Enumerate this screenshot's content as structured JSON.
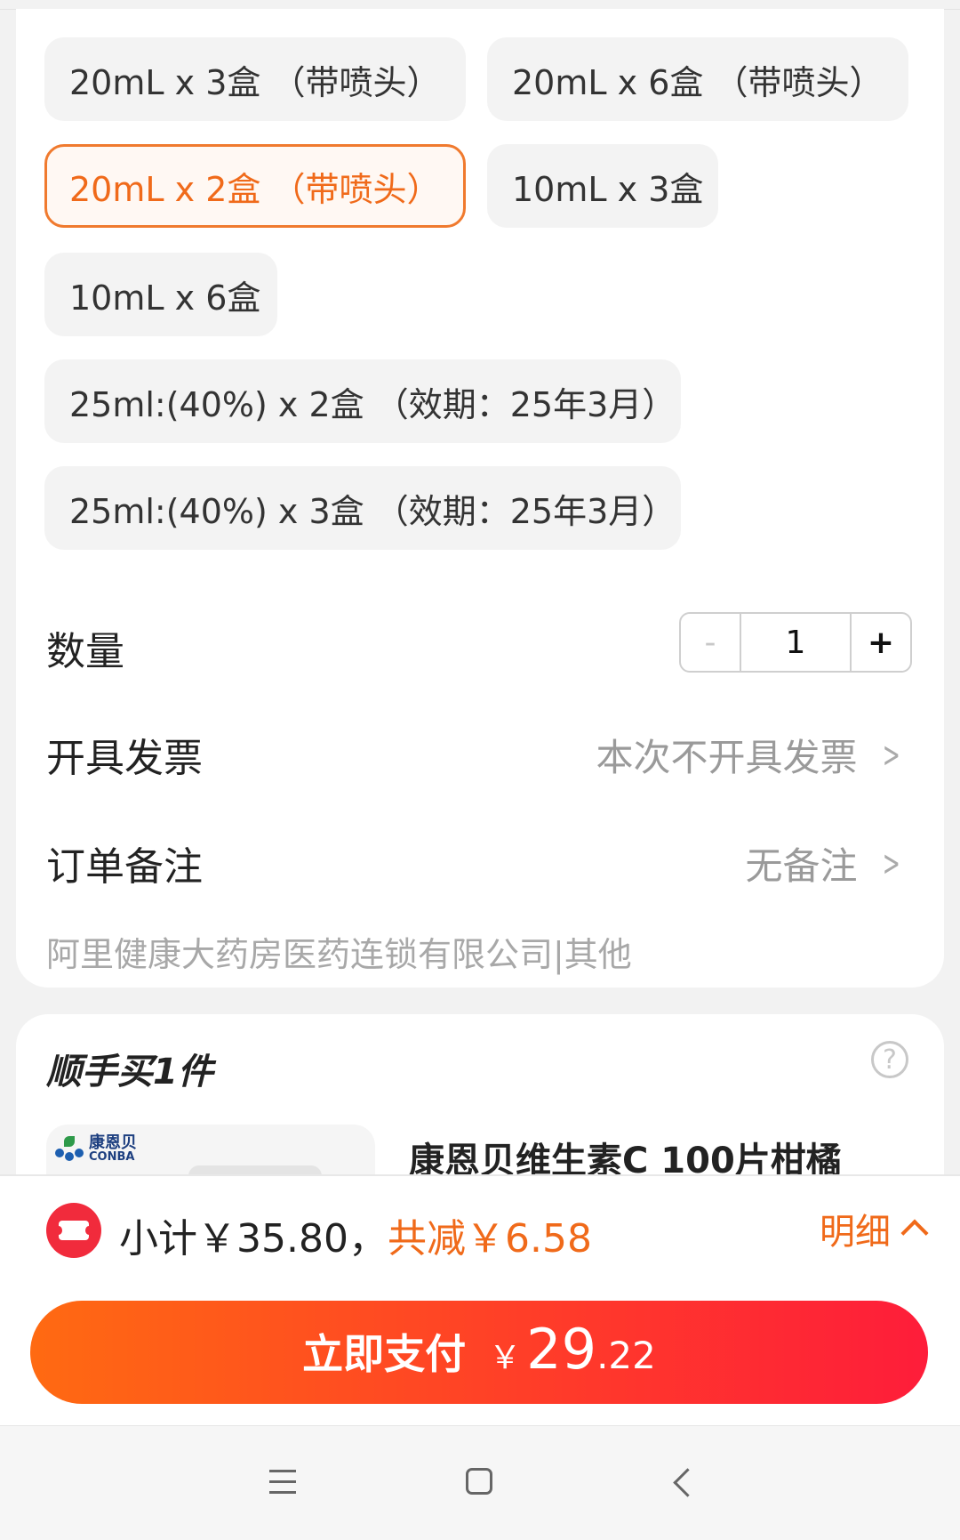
{
  "spec_options": [
    {
      "label": "20mL x 3盒 （带喷头）",
      "selected": false
    },
    {
      "label": "20mL x 6盒 （带喷头）",
      "selected": false
    },
    {
      "label": "20mL x 2盒 （带喷头）",
      "selected": true
    },
    {
      "label": "10mL x 3盒",
      "selected": false
    },
    {
      "label": "10mL x 6盒",
      "selected": false
    },
    {
      "label": "25ml:(40%) x 2盒 （效期：25年3月）",
      "selected": false
    },
    {
      "label": "25ml:(40%) x 3盒 （效期：25年3月）",
      "selected": false
    }
  ],
  "quantity": {
    "label": "数量",
    "minus": "-",
    "value": "1",
    "plus": "+"
  },
  "invoice": {
    "label": "开具发票",
    "value": "本次不开具发票"
  },
  "remark": {
    "label": "订单备注",
    "value": "无备注"
  },
  "shop": {
    "name": "阿里健康大药房医药连锁有限公司|其他"
  },
  "addon": {
    "title": "顺手买1件",
    "help": "?",
    "product_name": "康恩贝维生素C 100片柑橘",
    "brand_cn": "康恩贝",
    "brand_en": "CONBA"
  },
  "summary": {
    "subtotal": "小计￥35.80，",
    "discount": "共减￥6.58",
    "detail": "明细"
  },
  "pay": {
    "label": "立即支付",
    "currency": "￥",
    "amount_int": "29",
    "amount_dec": ".22"
  },
  "colors": {
    "accent": "#f06a1a",
    "pay_gradient_start": "#ff6a12",
    "pay_gradient_end": "#fe1d3a",
    "coupon": "#f12b3c"
  },
  "icons": {
    "coupon": "ticket-icon",
    "detail": "chevron-up-icon",
    "row": "chevron-right-icon",
    "help": "question-circle-icon"
  }
}
